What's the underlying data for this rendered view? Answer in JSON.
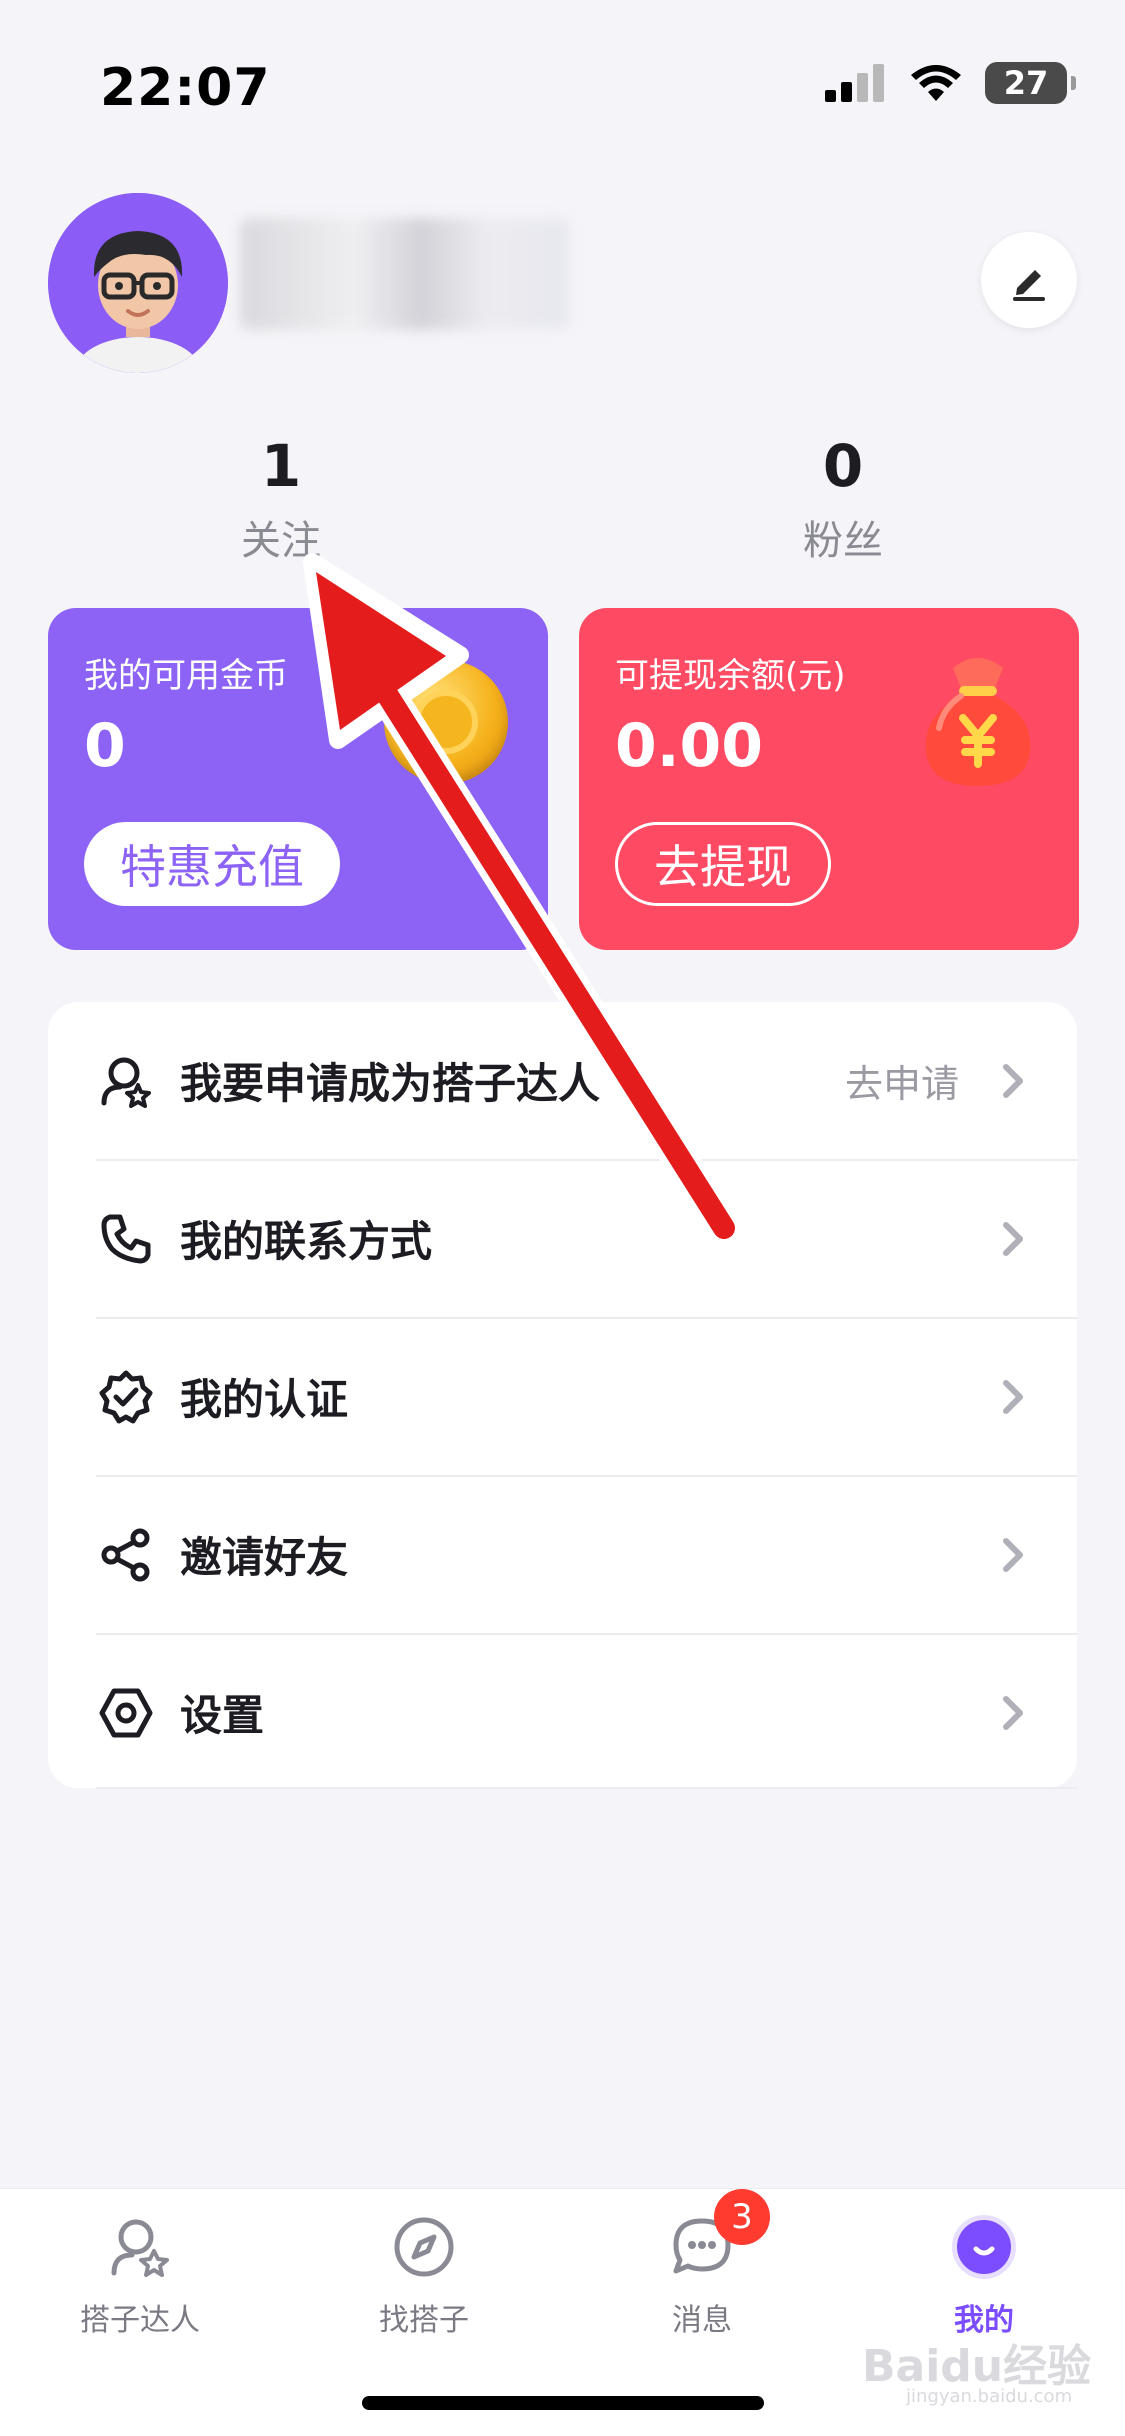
{
  "status_bar": {
    "time": "22:07",
    "battery": "27"
  },
  "profile": {
    "stats": [
      {
        "value": "1",
        "label": "关注"
      },
      {
        "value": "0",
        "label": "粉丝"
      }
    ]
  },
  "wallet": {
    "coins": {
      "title": "我的可用金币",
      "value": "0",
      "button": "特惠充值"
    },
    "cash": {
      "title": "可提现余额(元)",
      "value": "0.00",
      "button": "去提现"
    }
  },
  "menu": [
    {
      "label": "我要申请成为搭子达人",
      "extra": "去申请",
      "icon": "expert-icon"
    },
    {
      "label": "我的联系方式",
      "extra": "",
      "icon": "phone-icon"
    },
    {
      "label": "我的认证",
      "extra": "",
      "icon": "verified-badge-icon"
    },
    {
      "label": "邀请好友",
      "extra": "",
      "icon": "share-icon"
    },
    {
      "label": "设置",
      "extra": "",
      "icon": "settings-hexagon-icon"
    }
  ],
  "tabs": [
    {
      "label": "搭子达人",
      "icon": "expert-icon"
    },
    {
      "label": "找搭子",
      "icon": "compass-icon"
    },
    {
      "label": "消息",
      "icon": "chat-icon",
      "badge": "3"
    },
    {
      "label": "我的",
      "icon": "smile-icon",
      "active": true
    }
  ],
  "watermark": {
    "brand": "Baidu经验",
    "url": "jingyan.baidu.com"
  },
  "colors": {
    "accent": "#7c4dff",
    "coin_card": "#8c63f5",
    "cash_card": "#ff4a63",
    "annotation_arrow": "#e51c1c",
    "badge": "#ff3b30"
  }
}
